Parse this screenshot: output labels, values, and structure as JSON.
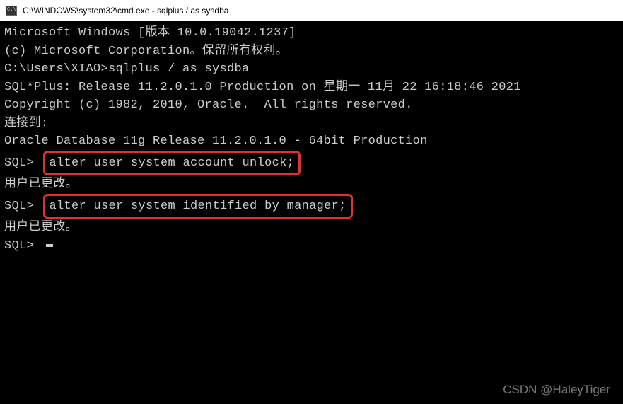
{
  "titlebar": {
    "title": "C:\\WINDOWS\\system32\\cmd.exe - sqlplus  / as sysdba"
  },
  "terminal": {
    "lines": {
      "l1": "Microsoft Windows [版本 10.0.19042.1237]",
      "l2": "(c) Microsoft Corporation。保留所有权利。",
      "l3": "",
      "l4_prompt": "C:\\Users\\XIAO>",
      "l4_cmd": "sqlplus / as sysdba",
      "l5": "",
      "l6": "SQL*Plus: Release 11.2.0.1.0 Production on 星期一 11月 22 16:18:46 2021",
      "l7": "",
      "l8": "Copyright (c) 1982, 2010, Oracle.  All rights reserved.",
      "l9": "",
      "l10": "",
      "l11": "连接到:",
      "l12": "Oracle Database 11g Release 11.2.0.1.0 - 64bit Production",
      "l13": "",
      "sql1_prompt": "SQL> ",
      "sql1_cmd": "alter user system account unlock;",
      "l15": "",
      "l16": "用户已更改。",
      "l17": "",
      "sql2_prompt": "SQL> ",
      "sql2_cmd": "alter user system identified by manager;",
      "l19": "",
      "l20": "用户已更改。",
      "l21": "",
      "sql3_prompt": "SQL> "
    }
  },
  "watermark": "CSDN @HaleyTiger"
}
